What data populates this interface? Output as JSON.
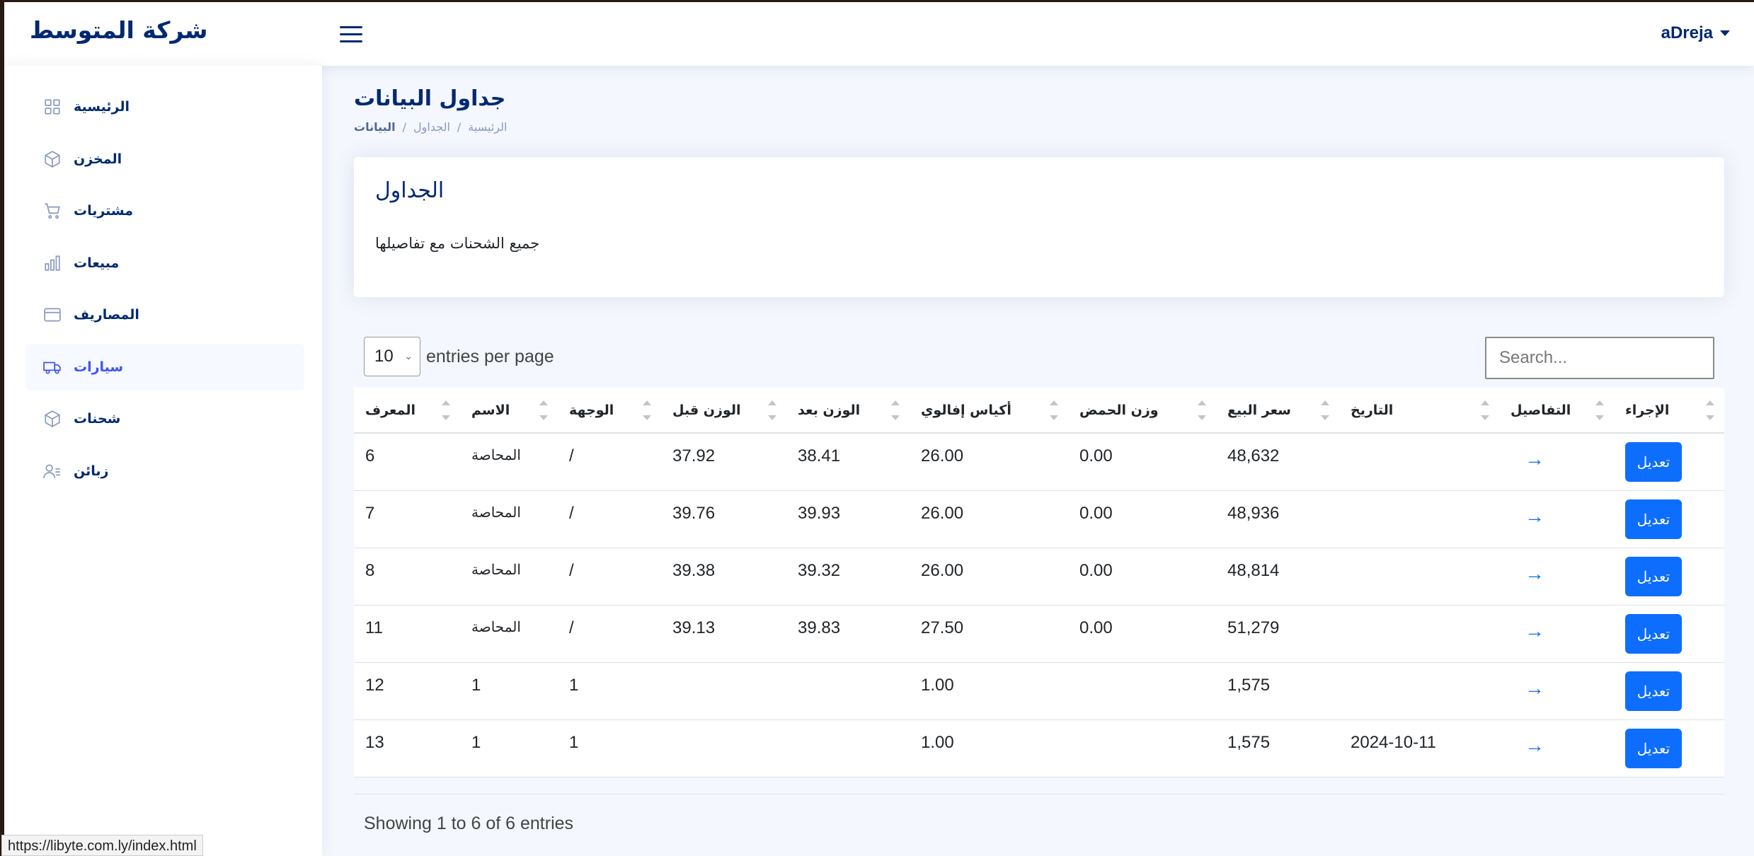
{
  "header": {
    "logo": "شركة المتوسط",
    "user": "aDreja"
  },
  "sidebar": {
    "items": [
      {
        "label": "الرئيسية",
        "icon": "grid-icon"
      },
      {
        "label": "المخزن",
        "icon": "box-icon"
      },
      {
        "label": "مشتريات",
        "icon": "cart-icon"
      },
      {
        "label": "مبيعات",
        "icon": "bar-chart-icon"
      },
      {
        "label": "المصاريف",
        "icon": "wallet-icon"
      },
      {
        "label": "سيارات",
        "icon": "truck-icon",
        "active": true
      },
      {
        "label": "شحنات",
        "icon": "box-icon"
      },
      {
        "label": "زبائن",
        "icon": "users-icon"
      }
    ]
  },
  "page": {
    "title": "جداول البيانات",
    "breadcrumb": [
      "البيانات",
      "الجداول",
      "الرئيسية"
    ],
    "breadcrumb_sep": "/"
  },
  "card": {
    "title": "الجداول",
    "text": "جميع الشحنات مع تفاصيلها"
  },
  "datatable": {
    "per_page_value": "10",
    "per_page_label": "entries per page",
    "search_placeholder": "Search...",
    "columns": [
      "المعرف",
      "الاسم",
      "الوجهة",
      "الوزن قبل",
      "الوزن بعد",
      "أكياس إفالوي",
      "وزن الحمض",
      "سعر البيع",
      "التاريخ",
      "التفاصيل",
      "الإجراء"
    ],
    "rows": [
      {
        "id": "6",
        "name": "المحاصة",
        "dest": "/",
        "w_before": "37.92",
        "w_after": "38.41",
        "bags": "26.00",
        "acid": "0.00",
        "price": "48,632",
        "date": "",
        "arrow": "→",
        "action": "تعديل"
      },
      {
        "id": "7",
        "name": "المحاصة",
        "dest": "/",
        "w_before": "39.76",
        "w_after": "39.93",
        "bags": "26.00",
        "acid": "0.00",
        "price": "48,936",
        "date": "",
        "arrow": "→",
        "action": "تعديل"
      },
      {
        "id": "8",
        "name": "المحاصة",
        "dest": "/",
        "w_before": "39.38",
        "w_after": "39.32",
        "bags": "26.00",
        "acid": "0.00",
        "price": "48,814",
        "date": "",
        "arrow": "→",
        "action": "تعديل"
      },
      {
        "id": "11",
        "name": "المحاصة",
        "dest": "/",
        "w_before": "39.13",
        "w_after": "39.83",
        "bags": "27.50",
        "acid": "0.00",
        "price": "51,279",
        "date": "",
        "arrow": "→",
        "action": "تعديل"
      },
      {
        "id": "12",
        "name": "1",
        "dest": "1",
        "w_before": "",
        "w_after": "",
        "bags": "1.00",
        "acid": "",
        "price": "1,575",
        "date": "",
        "arrow": "→",
        "action": "تعديل"
      },
      {
        "id": "13",
        "name": "1",
        "dest": "1",
        "w_before": "",
        "w_after": "",
        "bags": "1.00",
        "acid": "",
        "price": "1,575",
        "date": "2024-10-11",
        "arrow": "→",
        "action": "تعديل"
      }
    ],
    "info": "Showing 1 to 6 of 6 entries"
  },
  "status_bar": {
    "url": "https://libyte.com.ly/index.html"
  },
  "colors": {
    "brand": "#012970",
    "accent": "#4154f1",
    "primary_button": "#0d6efd",
    "background": "#f4f7fd"
  }
}
